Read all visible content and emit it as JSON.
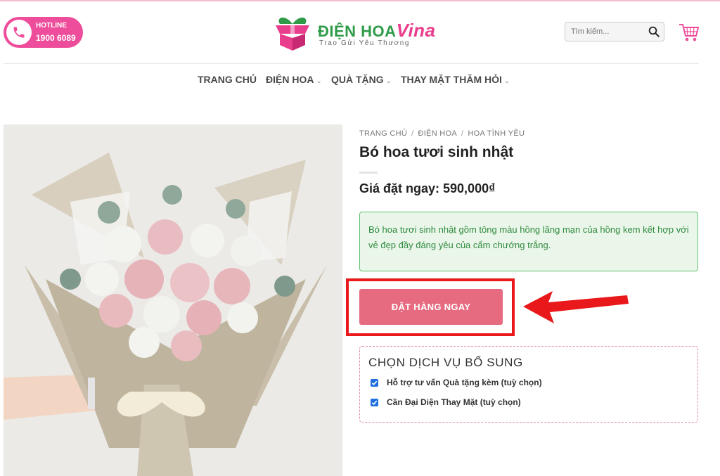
{
  "header": {
    "hotline_label": "HOTLINE",
    "hotline_number": "1900 6089",
    "logo_brand_main": "ĐIỆN HOA",
    "logo_brand_accent": "Vina",
    "logo_tagline": "Trao Gửi Yêu Thương",
    "search_placeholder": "Tìm kiếm...",
    "icons": [
      "phone-icon",
      "gift-box-logo",
      "search-icon",
      "cart-icon"
    ]
  },
  "nav": {
    "items": [
      {
        "label": "TRANG CHỦ",
        "has_dropdown": false
      },
      {
        "label": "ĐIỆN HOA",
        "has_dropdown": true
      },
      {
        "label": "QUÀ TẶNG",
        "has_dropdown": true
      },
      {
        "label": "THAY MẶT THĂM HỎI",
        "has_dropdown": true
      }
    ]
  },
  "breadcrumb": [
    "TRANG CHỦ",
    "ĐIỆN HOA",
    "HOA TÌNH YÊU"
  ],
  "product": {
    "title": "Bó hoa tươi sinh nhật",
    "price": "Giá đặt ngay: 590,000₫",
    "description": "Bó hoa tươi sinh nhật gồm tông màu hồng lãng mạn của hồng kem kết hợp với vẻ đẹp đầy đáng yêu của cẩm chướng trắng.",
    "order_button": "ĐẶT HÀNG NGAY"
  },
  "addons": {
    "title": "CHỌN DỊCH VỤ BỔ SUNG",
    "options": [
      {
        "label": "Hỗ trợ tư vấn Quà tặng kèm (tuỳ chọn)",
        "checked": true
      },
      {
        "label": "Cần Đại Diện Thay Mặt (tuỳ chọn)",
        "checked": true
      }
    ]
  },
  "colors": {
    "accent_pink": "#ee4d9b",
    "button": "#e66a80",
    "highlight_red": "#e8181b",
    "logo_green": "#2f9b48",
    "desc_bg": "#eaf6ea"
  }
}
